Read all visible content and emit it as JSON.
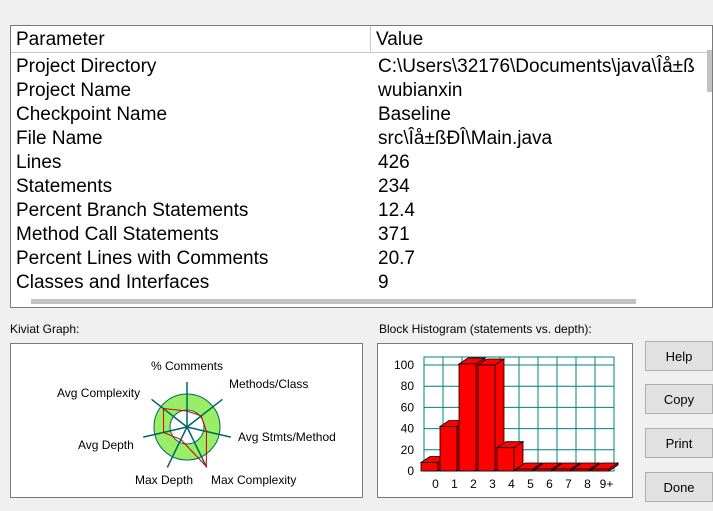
{
  "table": {
    "headers": {
      "parameter": "Parameter",
      "value": "Value"
    },
    "rows": [
      {
        "parameter": "Project Directory",
        "value": "C:\\Users\\32176\\Documents\\java\\Îå±ß"
      },
      {
        "parameter": "Project Name",
        "value": "wubianxin"
      },
      {
        "parameter": "Checkpoint Name",
        "value": "Baseline"
      },
      {
        "parameter": "File Name",
        "value": "src\\Îå±ßÐÎ\\Main.java"
      },
      {
        "parameter": "Lines",
        "value": "426"
      },
      {
        "parameter": "Statements",
        "value": "234"
      },
      {
        "parameter": "Percent Branch Statements",
        "value": "12.4"
      },
      {
        "parameter": "Method Call Statements",
        "value": "371"
      },
      {
        "parameter": "Percent Lines with Comments",
        "value": "20.7"
      },
      {
        "parameter": "Classes and Interfaces",
        "value": "9"
      }
    ]
  },
  "kiviat": {
    "title": "Kiviat Graph:",
    "axes": [
      "% Comments",
      "Methods/Class",
      "Avg Stmts/Method",
      "Max Complexity",
      "Max Depth",
      "Avg Depth",
      "Avg Complexity"
    ]
  },
  "histogram": {
    "title": "Block Histogram (statements vs. depth):",
    "bar_color": "#ff0000",
    "grid_color": "#008080"
  },
  "buttons": {
    "help": "Help",
    "copy": "Copy",
    "print": "Print",
    "done": "Done"
  },
  "chart_data": {
    "type": "bar",
    "categories": [
      "0",
      "1",
      "2",
      "3",
      "4",
      "5",
      "6",
      "7",
      "8",
      "9+"
    ],
    "values": [
      8,
      42,
      101,
      100,
      22,
      0,
      0,
      0,
      0,
      0
    ],
    "ylim": [
      0,
      100
    ],
    "yticks": [
      0,
      20,
      40,
      60,
      80,
      100
    ],
    "grid": true,
    "style": "3d"
  }
}
